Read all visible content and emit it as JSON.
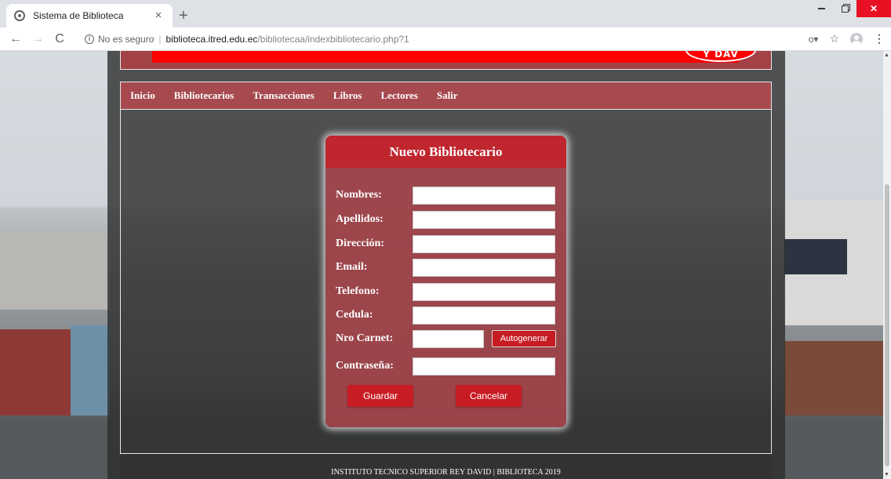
{
  "browser": {
    "tab_title": "Sistema de Biblioteca",
    "tab_close": "×",
    "new_tab": "+",
    "back": "←",
    "forward": "→",
    "reload": "C",
    "security_label": "No es seguro",
    "url_separator": "|",
    "url_host": "biblioteca.itred.edu.ec",
    "url_path": "/bibliotecaa/indexbibliotecario.php?1",
    "key_icon": "o▾",
    "star_icon": "☆",
    "menu_icon": "⋮",
    "close_glyph": "✕",
    "info_glyph": "i"
  },
  "banner": {
    "logo_text": "Y DAV"
  },
  "navbar": {
    "items": [
      {
        "label": "Inicio"
      },
      {
        "label": "Bibliotecarios"
      },
      {
        "label": "Transacciones"
      },
      {
        "label": "Libros"
      },
      {
        "label": "Lectores"
      },
      {
        "label": "Salir"
      }
    ]
  },
  "form": {
    "title": "Nuevo Bibliotecario",
    "fields": [
      {
        "label": "Nombres:",
        "value": ""
      },
      {
        "label": "Apellidos:",
        "value": ""
      },
      {
        "label": "Dirección:",
        "value": ""
      },
      {
        "label": "Email:",
        "value": ""
      },
      {
        "label": "Telefono:",
        "value": ""
      },
      {
        "label": "Cedula:",
        "value": ""
      },
      {
        "label": "Nro Carnet:",
        "value": ""
      },
      {
        "label": "Contraseña:",
        "value": ""
      }
    ],
    "autogen_label": "Autogenerar",
    "save_label": "Guardar",
    "cancel_label": "Cancelar"
  },
  "footer": {
    "text": "INSTITUTO TECNICO SUPERIOR REY DAVID | BIBLIOTECA 2019"
  },
  "colors": {
    "brand_red": "#c0262e",
    "navbar": "#a74a4f",
    "card": "#a8464c",
    "banner_red": "#ff0000"
  }
}
